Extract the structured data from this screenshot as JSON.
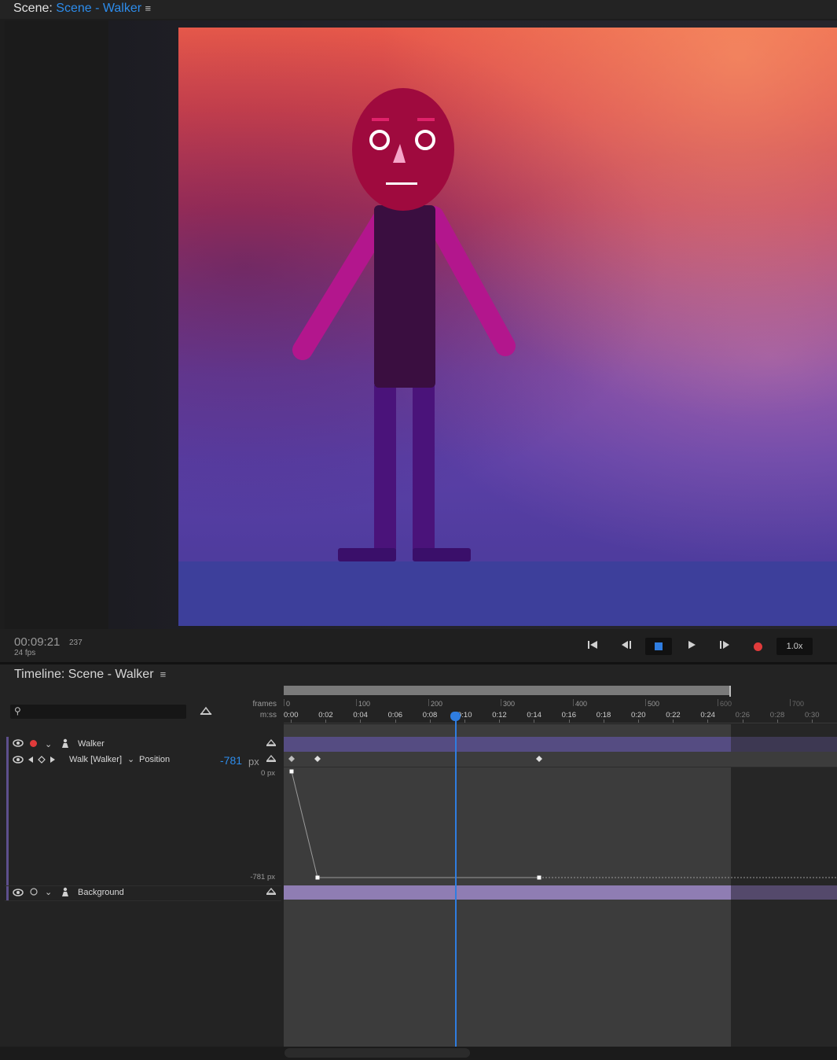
{
  "scene": {
    "title_prefix": "Scene:",
    "title_name": "Scene - Walker",
    "menu_icon": "hamburger-menu-icon"
  },
  "transport": {
    "timecode": "00:09:21",
    "frame": "237",
    "fps": "24 fps",
    "speed": "1.0x",
    "buttons": [
      "go-to-start",
      "step-back",
      "stop",
      "play",
      "step-forward",
      "record"
    ]
  },
  "timeline": {
    "title": "Timeline: Scene - Walker",
    "search_placeholder": "",
    "frames_label": "frames",
    "mss_label": "m:ss",
    "frame_ticks": [
      "0",
      "100",
      "200",
      "300",
      "400",
      "500",
      "600",
      "700"
    ],
    "time_ticks": [
      "0:00",
      "0:02",
      "0:04",
      "0:06",
      "0:08",
      "0:10",
      "0:12",
      "0:14",
      "0:16",
      "0:18",
      "0:20",
      "0:22",
      "0:24",
      "0:26",
      "0:28",
      "0:30"
    ],
    "layers": [
      {
        "name": "Walker"
      },
      {
        "name": "Background"
      }
    ],
    "property": {
      "behavior": "Walk [Walker]",
      "name": "Position",
      "value": "-781",
      "unit": "px",
      "range_top": "0 px",
      "range_bottom": "-781 px"
    }
  },
  "colors": {
    "accent_blue": "#2d8ceb",
    "record_red": "#e03b3b",
    "walker_track": "#554c82",
    "background_track": "#8f7db3"
  }
}
